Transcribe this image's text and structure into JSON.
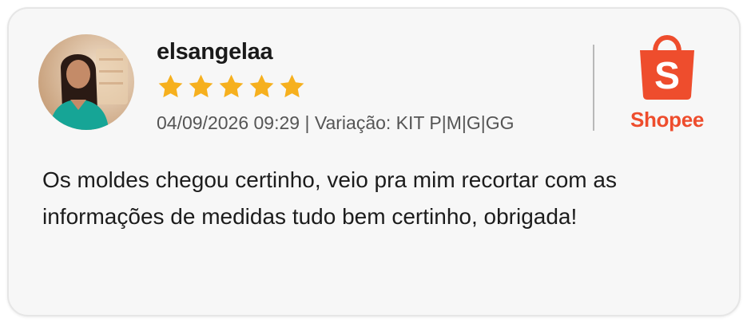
{
  "review": {
    "username": "elsangelaa",
    "rating": 5,
    "rating_max": 5,
    "date": "04/09/2026 09:29",
    "separator": "|",
    "variation": "Variação: KIT P|M|G|GG",
    "text": "Os moldes chegou certinho, veio pra mim recortar com as informações de medidas tudo bem certinho, obrigada!"
  },
  "brand": {
    "name": "Shopee",
    "bag_letter": "S",
    "color": "#ee4d2d"
  },
  "colors": {
    "star": "#f6b01e",
    "card_background": "#f7f7f7",
    "text_primary": "#1c1c1c",
    "text_secondary": "#555555"
  },
  "icons": [
    "user-avatar",
    "star-icon",
    "shopee-bag-icon"
  ]
}
